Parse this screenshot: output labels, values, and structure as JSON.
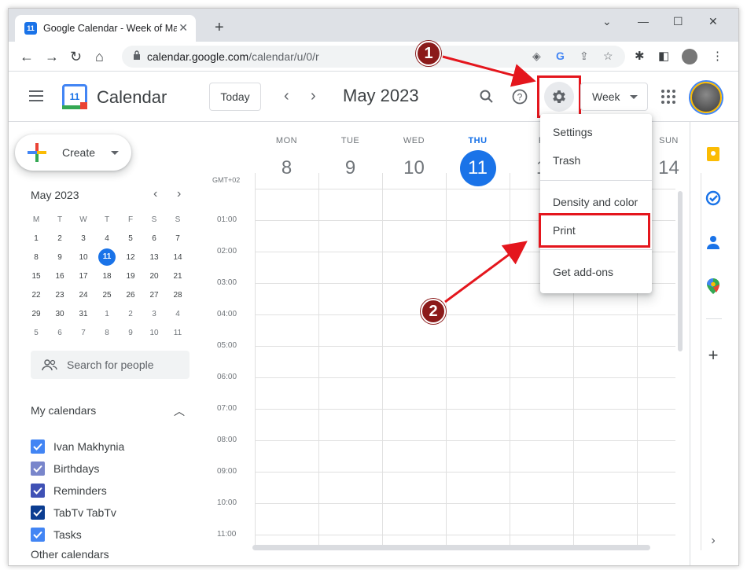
{
  "browser": {
    "tab_title": "Google Calendar - Week of May",
    "tab_favicon_text": "11",
    "url_host": "calendar.google.com",
    "url_path": "/calendar/u/0/r"
  },
  "header": {
    "app_title": "Calendar",
    "logo_text": "11",
    "today_label": "Today",
    "month_title": "May 2023",
    "view_label": "Week"
  },
  "sidebar": {
    "create_label": "Create",
    "mini_title": "May 2023",
    "mini_heads": [
      "M",
      "T",
      "W",
      "T",
      "F",
      "S",
      "S"
    ],
    "mini_weeks": [
      [
        "1",
        "2",
        "3",
        "4",
        "5",
        "6",
        "7"
      ],
      [
        "8",
        "9",
        "10",
        "11",
        "12",
        "13",
        "14"
      ],
      [
        "15",
        "16",
        "17",
        "18",
        "19",
        "20",
        "21"
      ],
      [
        "22",
        "23",
        "24",
        "25",
        "26",
        "27",
        "28"
      ],
      [
        "29",
        "30",
        "31",
        "1",
        "2",
        "3",
        "4"
      ],
      [
        "5",
        "6",
        "7",
        "8",
        "9",
        "10",
        "11"
      ]
    ],
    "search_people": "Search for people",
    "my_calendars_title": "My calendars",
    "calendars": [
      {
        "label": "Ivan Makhynia",
        "color": "#4285f4"
      },
      {
        "label": "Birthdays",
        "color": "#7986cb"
      },
      {
        "label": "Reminders",
        "color": "#3f51b5"
      },
      {
        "label": "TabTv TabTv",
        "color": "#0b3d91"
      },
      {
        "label": "Tasks",
        "color": "#4285f4"
      }
    ],
    "other_calendars_title": "Other calendars"
  },
  "week": {
    "timezone": "GMT+02",
    "days": [
      {
        "dow": "MON",
        "num": "8"
      },
      {
        "dow": "TUE",
        "num": "9"
      },
      {
        "dow": "WED",
        "num": "10"
      },
      {
        "dow": "THU",
        "num": "11"
      },
      {
        "dow": "F",
        "num": "1"
      },
      {
        "dow": "SAT",
        "num": "13"
      },
      {
        "dow": "SUN",
        "num": "14"
      }
    ],
    "hours": [
      "01:00",
      "02:00",
      "03:00",
      "04:00",
      "05:00",
      "06:00",
      "07:00",
      "08:00",
      "09:00",
      "10:00",
      "11:00"
    ]
  },
  "menu": {
    "settings": "Settings",
    "trash": "Trash",
    "density": "Density and color",
    "print": "Print",
    "addons": "Get add-ons"
  },
  "annotations": {
    "step1": "1",
    "step2": "2"
  },
  "colors": {
    "accent": "#1a73e8",
    "highlight": "#e4161d",
    "badge": "#8b1a1a"
  }
}
